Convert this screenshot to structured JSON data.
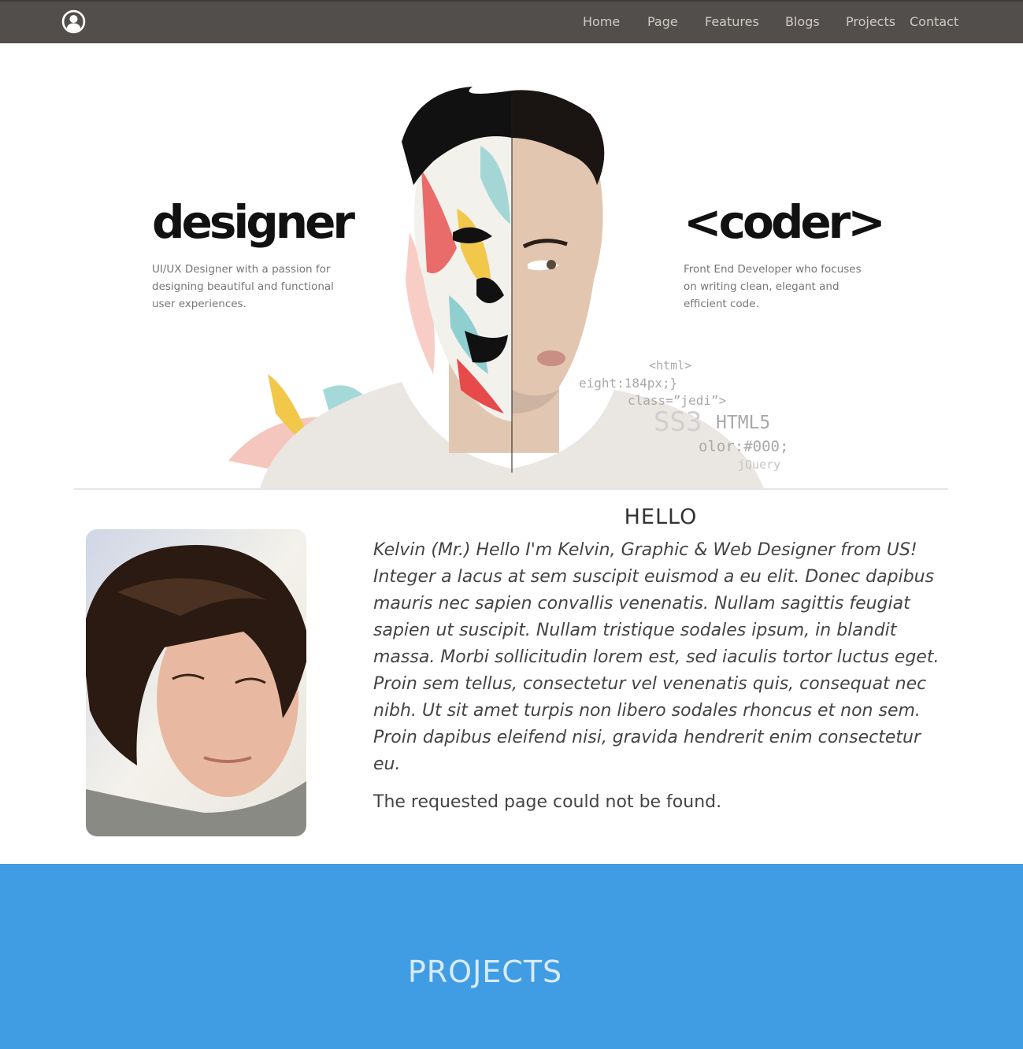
{
  "nav": {
    "items": [
      "Home",
      "Page",
      "Features",
      "Blogs",
      "Projects",
      "Contact"
    ]
  },
  "hero": {
    "left_title": "designer",
    "left_desc": "UI/UX Designer with a passion for designing beautiful and functional user experiences.",
    "right_title": "<coder>",
    "right_desc": "Front End Developer who focuses on writing clean, elegant and efficient code.",
    "code_snippets": [
      "<html>",
      "eight:184px;}",
      "class=”jedi”>",
      "SS3",
      "HTML5",
      "olor:#000;",
      "jQuery"
    ]
  },
  "about": {
    "heading": "HELLO",
    "bio": "Kelvin (Mr.) Hello I'm Kelvin, Graphic & Web Designer from US! Integer a lacus at sem suscipit euismod a eu elit. Donec dapibus mauris nec sapien convallis venenatis. Nullam sagittis feugiat sapien ut suscipit. Nullam tristique sodales ipsum, in blandit massa. Morbi sollicitudin lorem est, sed iaculis tortor luctus eget. Proin sem tellus, consectetur vel venenatis quis, consequat nec nibh. Ut sit amet turpis non libero sodales rhoncus et non sem. Proin dapibus eleifend nisi, gravida hendrerit enim consectetur eu.",
    "message": "The requested page could not be found."
  },
  "projects": {
    "heading": "PROJECTS"
  },
  "colors": {
    "navbar": "#524e4b",
    "projects_bg": "#419de3",
    "nav_text": "#cfcac6"
  },
  "icons": {
    "brand": "user-avatar-icon"
  }
}
